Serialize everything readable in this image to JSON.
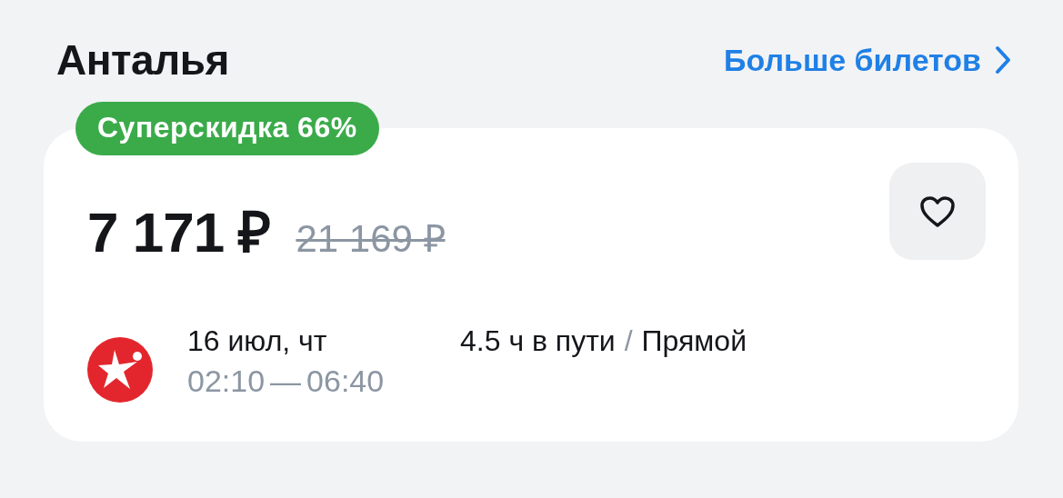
{
  "header": {
    "title": "Анталья",
    "more_link": "Больше билетов"
  },
  "offer": {
    "badge": "Суперскидка 66%",
    "price": "7 171 ₽",
    "old_price": "21 169 ₽",
    "favorite": false,
    "flight": {
      "date": "16 июл, чт",
      "departure": "02:10",
      "dash": "—",
      "arrival": "06:40",
      "duration": "4.5 ч в пути",
      "separator": "/",
      "route_type": "Прямой"
    }
  }
}
